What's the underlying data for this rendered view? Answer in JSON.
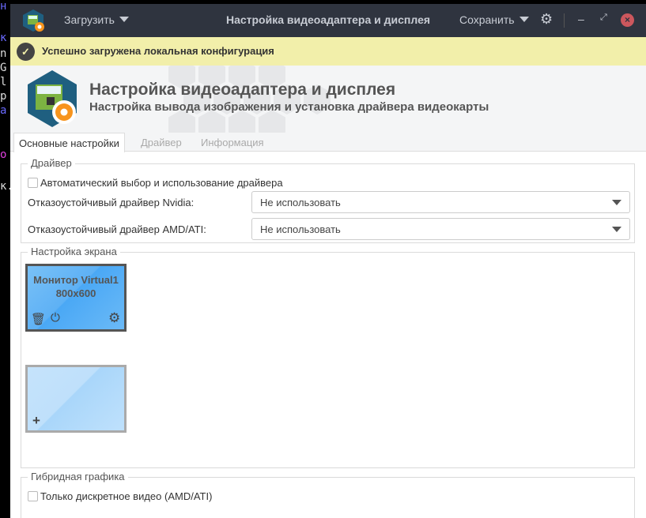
{
  "terminal_fragments": [
    "н",
    "к",
    "n",
    "G",
    "l",
    "p",
    "а",
    "о",
    "к."
  ],
  "titlebar": {
    "load_label": "Загрузить",
    "title": "Настройка видеоадаптера и дисплея",
    "save_label": "Сохранить"
  },
  "banner": {
    "message": "Успешно загружена локальная конфигурация"
  },
  "header": {
    "title": "Настройка видеоадаптера и дисплея",
    "subtitle": "Настройка вывода изображения и установка драйвера видеокарты"
  },
  "tabs": [
    {
      "label": "Основные настройки"
    },
    {
      "label": "Драйвер"
    },
    {
      "label": "Информация"
    }
  ],
  "driver": {
    "legend": "Драйвер",
    "auto_label": "Автоматический выбор и использование драйвера",
    "auto_checked": false,
    "nvidia_label": "Отказоустойчивый драйвер Nvidia:",
    "nvidia_value": "Не использовать",
    "amd_label": "Отказоустойчивый драйвер AMD/ATI:",
    "amd_value": "Не использовать"
  },
  "screen": {
    "legend": "Настройка экрана",
    "monitor_name": "Монитор Virtual1",
    "monitor_res": "800x600",
    "add_label": "+"
  },
  "hybrid": {
    "legend": "Гибридная графика",
    "discrete_label": "Только дискретное видео (AMD/ATI)",
    "discrete_checked": false
  },
  "colors": {
    "titlebar": "#2f343f",
    "banner": "#f2efaa",
    "close": "#cc575d",
    "monitor": "#5eb1f5"
  }
}
